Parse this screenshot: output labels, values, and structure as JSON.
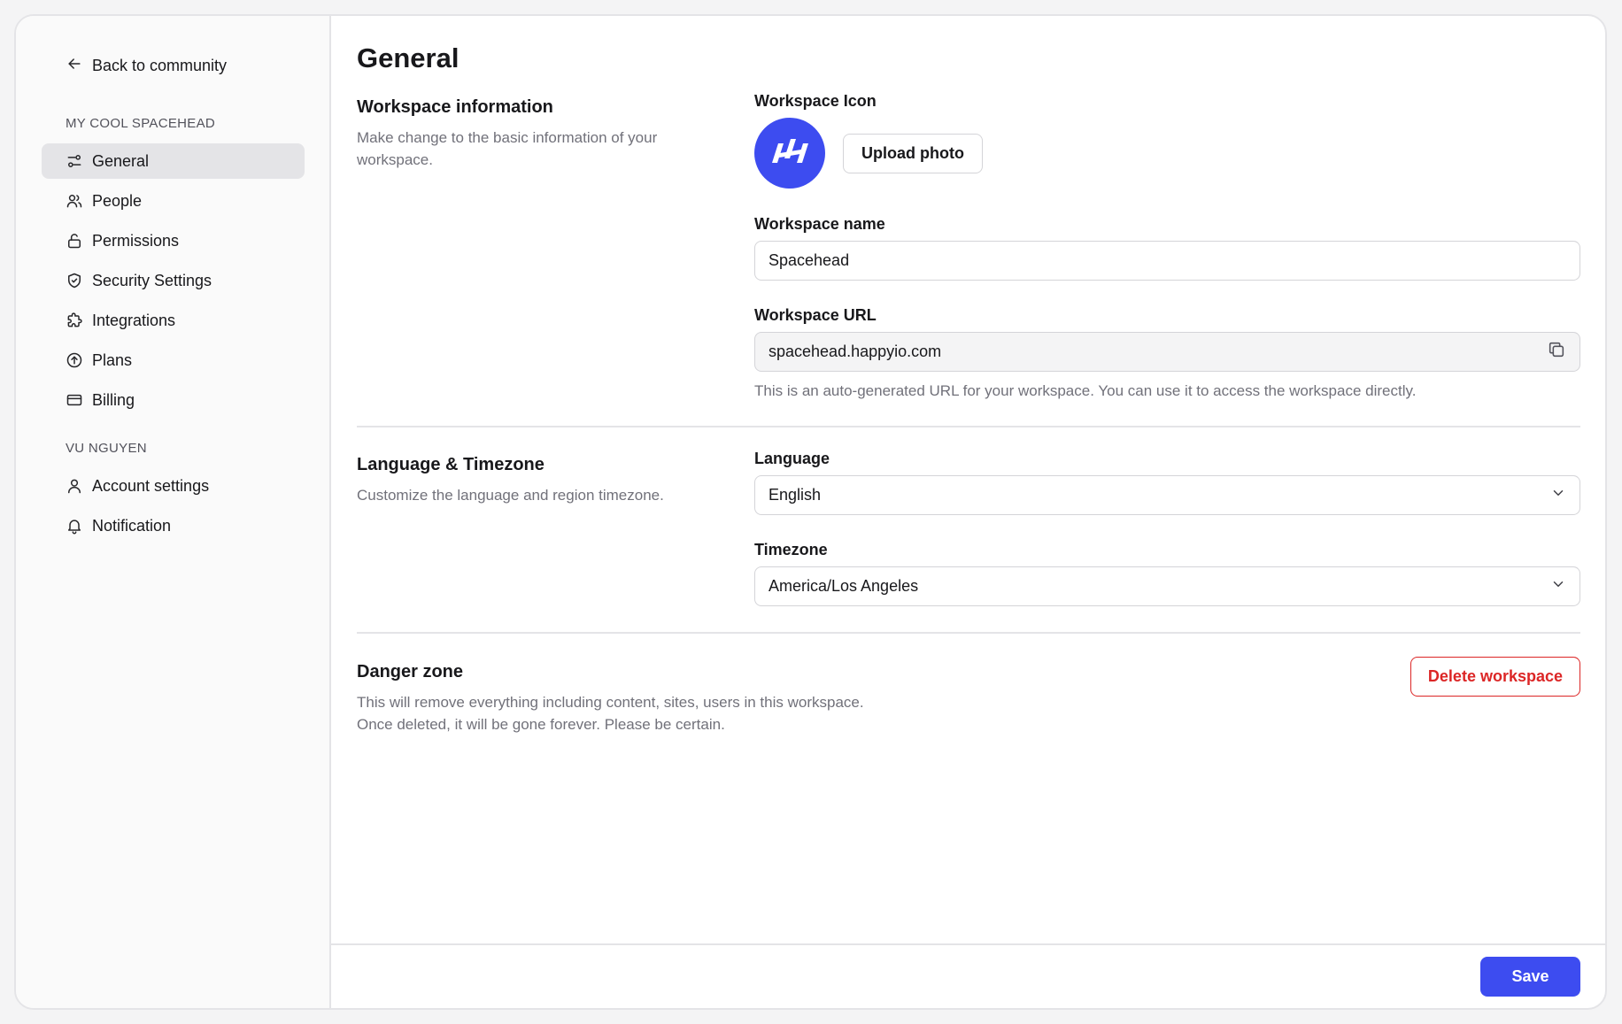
{
  "sidebar": {
    "back_label": "Back to community",
    "workspace_section_label": "MY COOL SPACEHEAD",
    "workspace_items": [
      {
        "label": "General",
        "icon": "sliders-icon",
        "active": true
      },
      {
        "label": "People",
        "icon": "users-icon"
      },
      {
        "label": "Permissions",
        "icon": "lock-icon"
      },
      {
        "label": "Security Settings",
        "icon": "shield-icon"
      },
      {
        "label": "Integrations",
        "icon": "puzzle-icon"
      },
      {
        "label": "Plans",
        "icon": "arrow-up-circle-icon"
      },
      {
        "label": "Billing",
        "icon": "credit-card-icon"
      }
    ],
    "user_section_label": "VU NGUYEN",
    "user_items": [
      {
        "label": "Account settings",
        "icon": "user-icon"
      },
      {
        "label": "Notification",
        "icon": "bell-icon"
      }
    ]
  },
  "main": {
    "title": "General",
    "workspace_info": {
      "title": "Workspace information",
      "description": "Make change to the basic information of your workspace.",
      "icon_label": "Workspace Icon",
      "upload_label": "Upload photo",
      "name_label": "Workspace name",
      "name_value": "Spacehead",
      "url_label": "Workspace URL",
      "url_value": "spacehead.happyio.com",
      "url_hint": "This is an auto-generated URL for your workspace. You can use it to access the workspace directly."
    },
    "language_timezone": {
      "title": "Language & Timezone",
      "description": "Customize the language and region timezone.",
      "language_label": "Language",
      "language_value": "English",
      "timezone_label": "Timezone",
      "timezone_value": "America/Los Angeles"
    },
    "danger_zone": {
      "title": "Danger zone",
      "description_line1": "This will remove everything including content, sites, users in this workspace.",
      "description_line2": "Once deleted, it will be gone forever. Please be certain.",
      "delete_label": "Delete workspace"
    },
    "save_label": "Save"
  },
  "colors": {
    "accent": "#3d4cf0",
    "danger": "#dc2626",
    "sidebar_bg": "#fafafa",
    "active_item_bg": "#e4e4e7"
  }
}
